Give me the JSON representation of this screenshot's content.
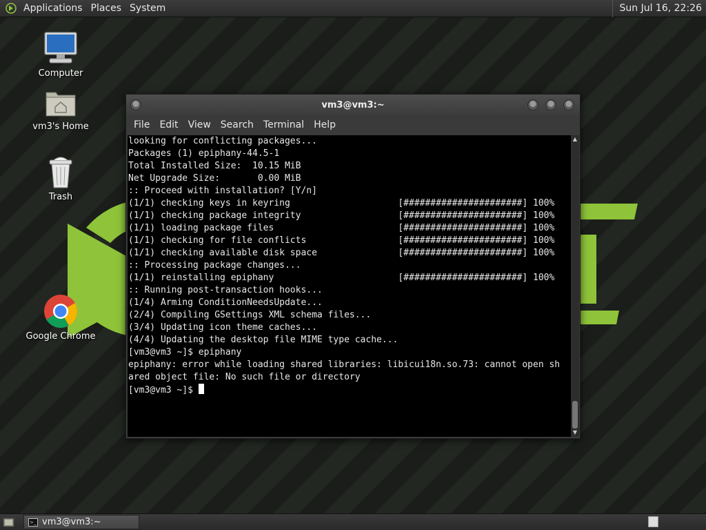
{
  "top_panel": {
    "menus": [
      "Applications",
      "Places",
      "System"
    ],
    "clock": "Sun Jul 16, 22:26"
  },
  "desktop": {
    "icons": [
      {
        "label": "Computer",
        "icon": "computer-icon"
      },
      {
        "label": "vm3's Home",
        "icon": "home-folder-icon"
      },
      {
        "label": "Trash",
        "icon": "trash-icon"
      },
      {
        "label": "Google Chrome",
        "icon": "chrome-icon"
      }
    ]
  },
  "terminal": {
    "title": "vm3@vm3:~",
    "menus": [
      "File",
      "Edit",
      "View",
      "Search",
      "Terminal",
      "Help"
    ],
    "lines": [
      "looking for conflicting packages...",
      "",
      "Packages (1) epiphany-44.5-1",
      "",
      "Total Installed Size:  10.15 MiB",
      "Net Upgrade Size:       0.00 MiB",
      "",
      ":: Proceed with installation? [Y/n]",
      "(1/1) checking keys in keyring                    [######################] 100%",
      "(1/1) checking package integrity                  [######################] 100%",
      "(1/1) loading package files                       [######################] 100%",
      "(1/1) checking for file conflicts                 [######################] 100%",
      "(1/1) checking available disk space               [######################] 100%",
      ":: Processing package changes...",
      "(1/1) reinstalling epiphany                       [######################] 100%",
      ":: Running post-transaction hooks...",
      "(1/4) Arming ConditionNeedsUpdate...",
      "(2/4) Compiling GSettings XML schema files...",
      "(3/4) Updating icon theme caches...",
      "(4/4) Updating the desktop file MIME type cache...",
      "[vm3@vm3 ~]$ epiphany",
      "epiphany: error while loading shared libraries: libicui18n.so.73: cannot open sh",
      "ared object file: No such file or directory"
    ],
    "prompt": "[vm3@vm3 ~]$ "
  },
  "bottom_panel": {
    "task_label": "vm3@vm3:~"
  },
  "colors": {
    "logo_green": "#8fc33a",
    "terminal_bg": "#000000",
    "panel_bg": "#2f2f2f"
  }
}
